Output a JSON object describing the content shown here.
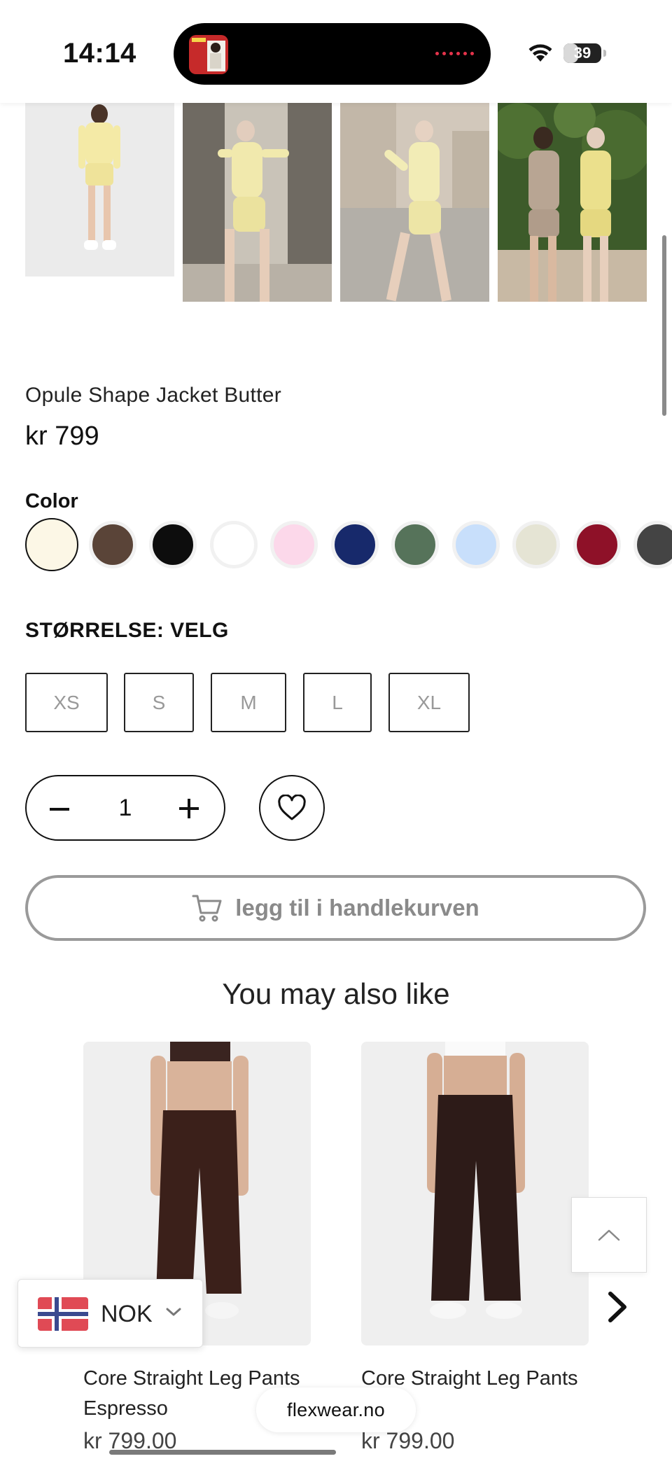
{
  "status_bar": {
    "time": "14:14",
    "battery": "39",
    "battery_level": 0.39
  },
  "product": {
    "title": "Opule Shape Jacket Butter",
    "price": "kr 799",
    "color_label": "Color",
    "colors": [
      "#fcf7e6",
      "#5a4438",
      "#0d0d0d",
      "#ffffff",
      "#fcd8ea",
      "#17296b",
      "#56735a",
      "#c8dffb",
      "#e5e4d4",
      "#8e1128",
      "#444444"
    ],
    "selected_color_index": 0,
    "size_label": "STØRRELSE: VELG",
    "sizes": [
      "XS",
      "S",
      "M",
      "L",
      "XL"
    ],
    "quantity": "1",
    "add_to_cart": "legg til i handlekurven"
  },
  "recommendations": {
    "heading": "You may also like",
    "items": [
      {
        "name": "Core Straight Leg Pants Espresso",
        "price": "kr 799.00"
      },
      {
        "name": "Core Straight Leg Pants",
        "price": "kr 799.00"
      }
    ]
  },
  "currency": {
    "code": "NOK"
  },
  "browser": {
    "url": "flexwear.no"
  },
  "icons": [
    "wifi-icon",
    "battery-icon",
    "minus-icon",
    "plus-icon",
    "heart-icon",
    "cart-icon",
    "chevron-up-icon",
    "chevron-right-icon",
    "chevron-down-icon",
    "norway-flag-icon"
  ]
}
